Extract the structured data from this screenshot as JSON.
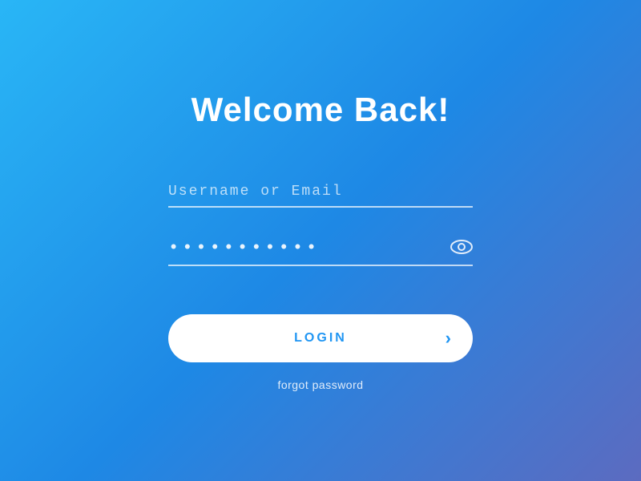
{
  "page": {
    "title": "Welcome Back!",
    "background_gradient_start": "#29b6f6",
    "background_gradient_end": "#5c6bc0"
  },
  "form": {
    "username_placeholder": "Username or Email",
    "password_placeholder": "••••••••••••••",
    "password_value": "••••••••••••••",
    "login_button_label": "LOGIN",
    "forgot_password_label": "forgot password",
    "eye_icon_label": "eye-icon",
    "chevron_icon_label": "›"
  }
}
